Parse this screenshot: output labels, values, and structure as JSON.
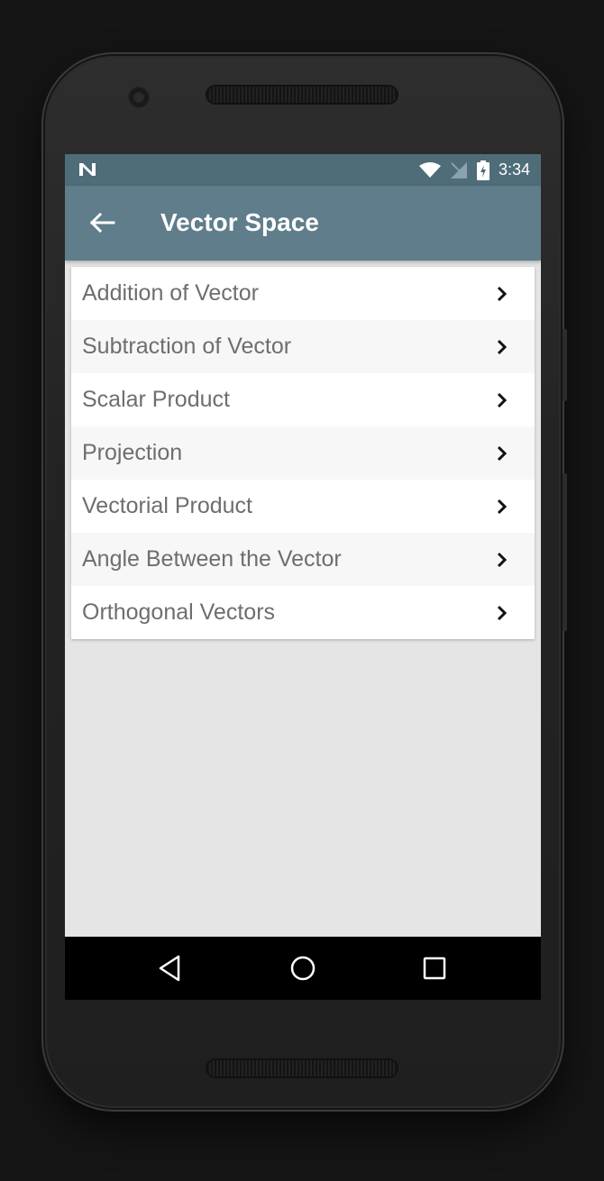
{
  "status_bar": {
    "time": "3:34"
  },
  "app_bar": {
    "title": "Vector Space"
  },
  "list": {
    "items": [
      {
        "label": "Addition of Vector"
      },
      {
        "label": "Subtraction of Vector"
      },
      {
        "label": "Scalar Product"
      },
      {
        "label": "Projection"
      },
      {
        "label": "Vectorial Product"
      },
      {
        "label": "Angle Between the Vector"
      },
      {
        "label": "Orthogonal Vectors"
      }
    ]
  },
  "icons": {
    "status_left": "n-logo-icon",
    "status_right": [
      "wifi-icon",
      "no-sim-icon",
      "battery-charging-icon"
    ],
    "back": "arrow-left-icon",
    "chevron": "chevron-right-icon",
    "nav": [
      "back-triangle-icon",
      "home-circle-icon",
      "recents-square-icon"
    ]
  },
  "colors": {
    "status_bar": "#4f6c79",
    "app_bar": "#607d8b",
    "background": "#e5e5e5",
    "item_text": "#6e6e6e"
  }
}
